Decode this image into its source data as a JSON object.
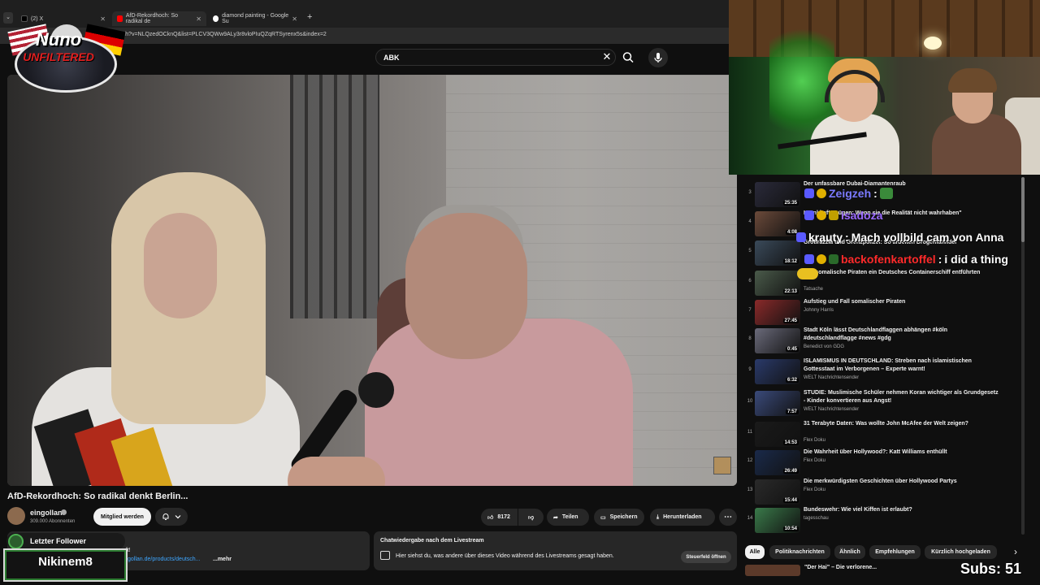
{
  "browser": {
    "tabs": [
      {
        "label": "(2) X",
        "favicon_color": "#000000"
      },
      {
        "label": "AfD-Rekordhoch: So radikal de",
        "favicon_color": "#ff0000"
      },
      {
        "label": "diamond painting - Google Su",
        "favicon_color": "#4285f4"
      }
    ],
    "new_tab": "+",
    "url": "m/watch?v=NLQzedOCknQ&list=PLCV3QWw9ALy3r8vloPIuQZqRTSyrenx5s&index=2"
  },
  "search": {
    "value": "ABK",
    "clear": "✕"
  },
  "overlay_logo": {
    "line1": "Nuno",
    "line2": "UNFILTERED"
  },
  "video": {
    "title": "AfD-Rekordhoch: So radikal denkt Berlin...",
    "channel": "eingollan",
    "subscribers": "309.000 Abonnenten",
    "member_button": "Mitglied werden",
    "likes": "8172",
    "share": "Teilen",
    "save": "Speichern",
    "download": "Herunterladen",
    "more": "⋯"
  },
  "description": {
    "line1": "auft!",
    "link": "gollan.de/products/deutsch...",
    "more": "...mehr"
  },
  "chat_replay": {
    "title": "Chatwiedergabe nach dem Livestream",
    "text": "Hier siehst du, was andere über dieses Video während des Livestreams gesagt haben.",
    "button": "Steuerfeld öffnen"
  },
  "follower": {
    "label": "Letzter Follower",
    "name": "Nikinem8"
  },
  "recommendations": [
    {
      "index": "3",
      "title": "Der unfassbare Dubai-Diamantenraub",
      "channel": "",
      "duration": "25:35",
      "thumb": "#2a2a3a"
    },
    {
      "index": "4",
      "title": "Krankhafte Lügen: Wenn sie die Realität nicht wahrhaben\"",
      "channel": "",
      "duration": "4:08",
      "thumb": "#6b4a3a"
    },
    {
      "index": "5",
      "title": "Großrazzia und Grenzpolizei: So arbeiten Drogenfahnder",
      "channel": "",
      "duration": "18:12",
      "thumb": "#3a4a5a"
    },
    {
      "index": "6",
      "title": "Wie somalische Piraten ein Deutsches Containerschiff entführten",
      "channel": "Tatsache",
      "duration": "22:13",
      "thumb": "#4a5a4a"
    },
    {
      "index": "7",
      "title": "Aufstieg und Fall somalischer Piraten",
      "channel": "Johnny Harris",
      "duration": "27:45",
      "thumb": "#8a2a2a"
    },
    {
      "index": "8",
      "title": "Stadt Köln lässt Deutschlandflaggen abhängen #köln #deutschlandflagge #news #gdg",
      "channel": "Benedict von GDG",
      "duration": "0:45",
      "thumb": "#6a6a7a"
    },
    {
      "index": "9",
      "title": "ISLAMISMUS IN DEUTSCHLAND: Streben nach islamistischen Gottesstaat im Verborgenen – Experte warnt!",
      "channel": "WELT Nachrichtensender",
      "duration": "6:32",
      "thumb": "#2a3a6a"
    },
    {
      "index": "10",
      "title": "STUDIE: Muslimische Schüler nehmen Koran wichtiger als Grundgesetz - Kinder konvertieren aus Angst!",
      "channel": "WELT Nachrichtensender",
      "duration": "7:57",
      "thumb": "#3a4a7a"
    },
    {
      "index": "11",
      "title": "31 Terabyte Daten: Was wollte John McAfee der Welt zeigen?",
      "channel": "Flex Doku",
      "duration": "14:53",
      "thumb": "#1a1a1a"
    },
    {
      "index": "12",
      "title": "Die Wahrheit über Hollywood?: Katt Williams enthüllt",
      "channel": "Flex Doku",
      "duration": "26:49",
      "thumb": "#1a2a4a"
    },
    {
      "index": "13",
      "title": "Die merkwürdigsten Geschichten über Hollywood Partys",
      "channel": "Flex Doku",
      "duration": "15:44",
      "thumb": "#2a2a2a"
    },
    {
      "index": "14",
      "title": "Bundeswehr: Wie viel Kiffen ist erlaubt?",
      "channel": "tagesschau",
      "duration": "10:54",
      "thumb": "#3a7a4a"
    }
  ],
  "chat_overlay": [
    {
      "user": "Zeigzeh",
      "message": "",
      "color": "#7a7aff"
    },
    {
      "user": "isadoza",
      "message": "",
      "color": "#9a6aff"
    },
    {
      "user": "krauty",
      "message": "Mach vollbild cam von Anna",
      "color": "#ffffff"
    },
    {
      "user": "backofenkartoffel",
      "message": "i did a thing",
      "color": "#ff2a2a"
    }
  ],
  "filter_chips": [
    "Alle",
    "Politiknachrichten",
    "Ähnlich",
    "Empfehlungen",
    "Kürzlich hochgeladen"
  ],
  "chip_next": "›",
  "subs_counter": "Subs: 51",
  "bottom_rec_title": "\"Der Hai\" – Die verlorene..."
}
